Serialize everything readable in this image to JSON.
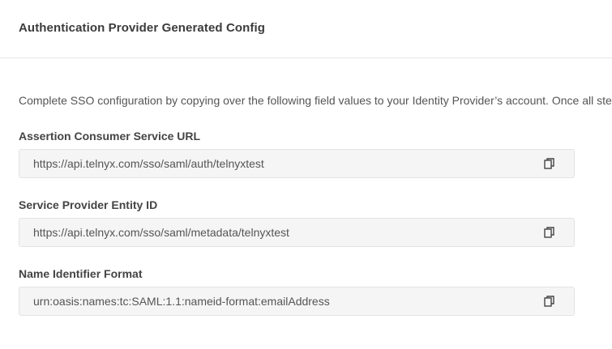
{
  "header": {
    "title": "Authentication Provider Generated Config"
  },
  "intro": {
    "text": "Complete SSO configuration by copying over the following field values to your Identity Provider’s account. Once all step"
  },
  "fields": [
    {
      "label": "Assertion Consumer Service URL",
      "value": "https://api.telnyx.com/sso/saml/auth/telnyxtest"
    },
    {
      "label": "Service Provider Entity ID",
      "value": "https://api.telnyx.com/sso/saml/metadata/telnyxtest"
    },
    {
      "label": "Name Identifier Format",
      "value": "urn:oasis:names:tc:SAML:1.1:nameid-format:emailAddress"
    }
  ],
  "icons": {
    "copy": "copy-icon"
  },
  "colors": {
    "field_background": "#f5f5f5",
    "border": "#e3e3e3"
  }
}
